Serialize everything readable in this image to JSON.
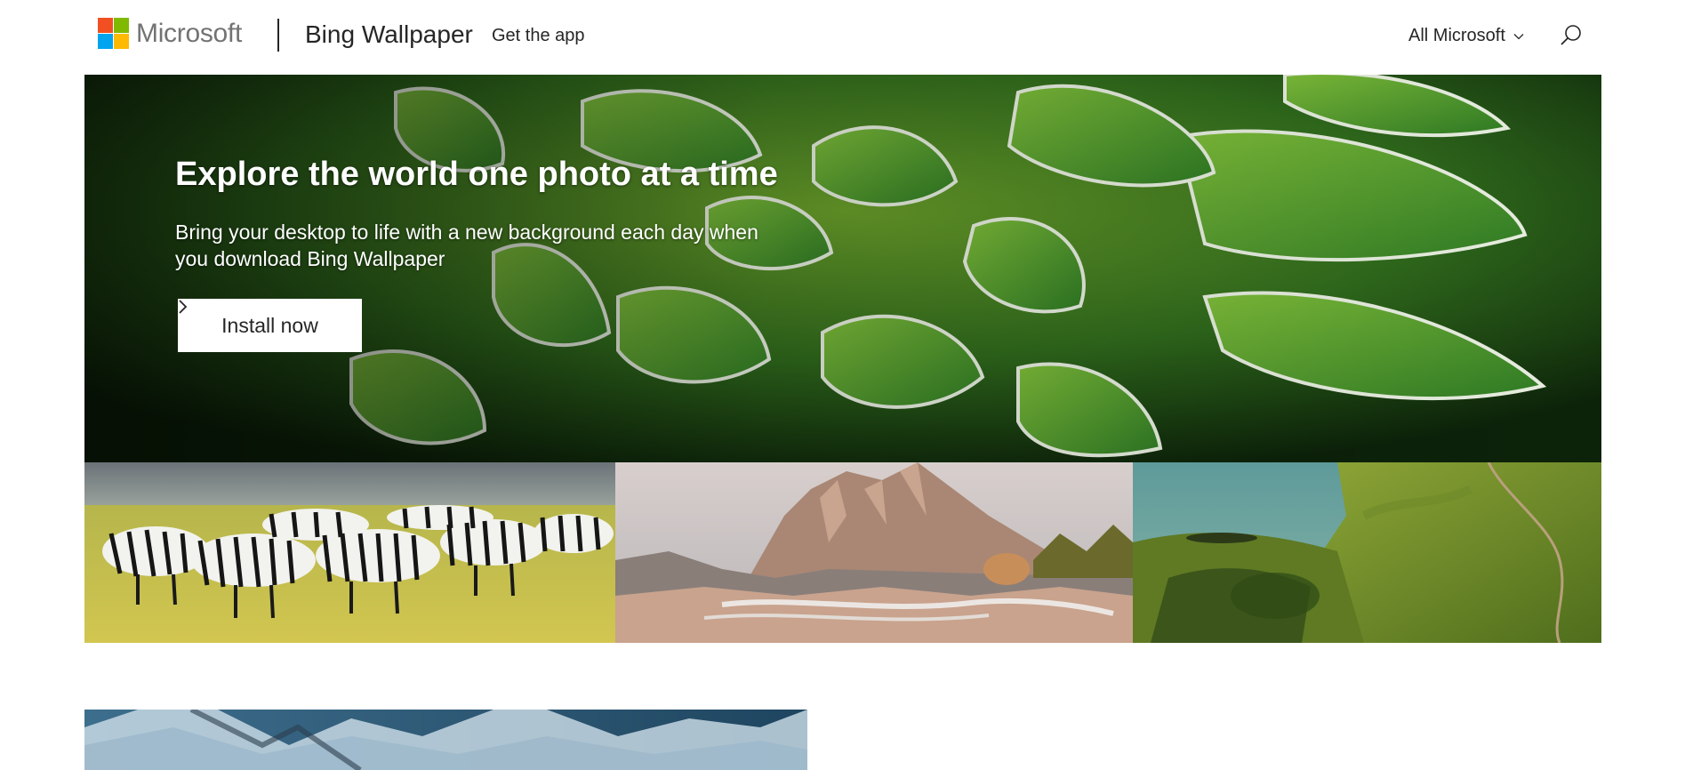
{
  "header": {
    "brand": "Microsoft",
    "product": "Bing Wallpaper",
    "get_app": "Get the app",
    "all_microsoft": "All Microsoft",
    "logo_colors": [
      "#f25022",
      "#7fba00",
      "#00a4ef",
      "#ffb900"
    ]
  },
  "hero": {
    "title": "Explore the world one photo at a time",
    "subtitle": "Bring your desktop to life with a new background each day when you download Bing Wallpaper",
    "install_label": "Install now"
  },
  "icons": {
    "search": "search-icon",
    "chevron": "chevron-down-icon",
    "arrow": "chevron-right-icon"
  }
}
